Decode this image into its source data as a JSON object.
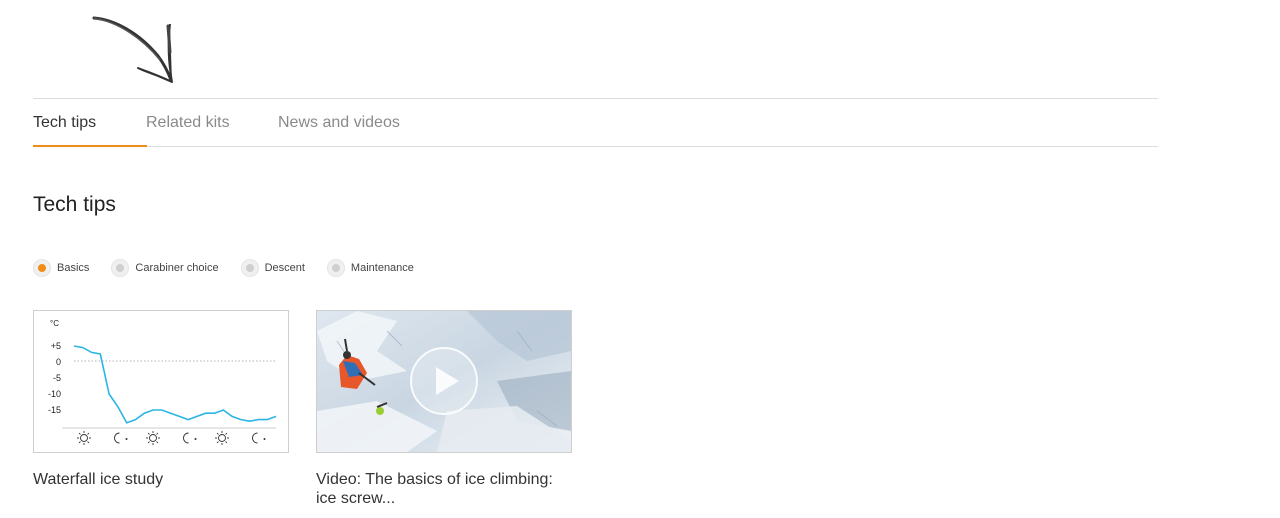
{
  "tabs": [
    {
      "label": "Tech tips",
      "active": true
    },
    {
      "label": "Related kits",
      "active": false
    },
    {
      "label": "News and videos",
      "active": false
    }
  ],
  "section_title": "Tech tips",
  "filters": [
    {
      "label": "Basics",
      "checked": true
    },
    {
      "label": "Carabiner choice",
      "checked": false
    },
    {
      "label": "Descent",
      "checked": false
    },
    {
      "label": "Maintenance",
      "checked": false
    }
  ],
  "cards": [
    {
      "caption": "Waterfall ice study",
      "type": "chart"
    },
    {
      "caption": "Video: The basics of ice climbing: ice screw...",
      "type": "video"
    }
  ],
  "chart_data": {
    "type": "line",
    "ylabel": "°C",
    "yticks": [
      "+5",
      "0",
      "-5",
      "-10",
      "-15"
    ],
    "ylim": [
      -20,
      10
    ],
    "series": [
      {
        "values": [
          5,
          4.5,
          3,
          2.5,
          -10,
          -14,
          -19,
          -18,
          -16,
          -15,
          -15,
          -16,
          -17,
          -18,
          -17,
          -16,
          -16,
          -15,
          -17,
          -18,
          -18.5,
          -18,
          -18,
          -17
        ]
      }
    ],
    "x_icons": [
      "sun-icon",
      "moon-icon",
      "sun-icon",
      "moon-icon",
      "sun-icon",
      "moon-icon"
    ],
    "colors": {
      "line": "#2bb5e4"
    }
  },
  "colors": {
    "accent": "#f28c1a"
  }
}
